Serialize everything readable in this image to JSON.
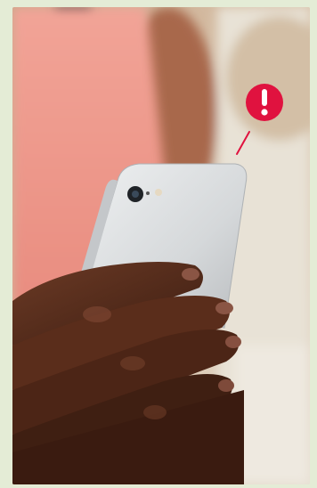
{
  "image": {
    "subject": "hand-holding-smartphone",
    "alert_icon": "exclamation-icon",
    "alert_glyph": "!",
    "colors": {
      "frame": "#e4ecd6",
      "alert": "#e0123f",
      "phone": "#d7d9db",
      "shirt": "#e98f85",
      "skin": "#5b2e1c"
    }
  }
}
